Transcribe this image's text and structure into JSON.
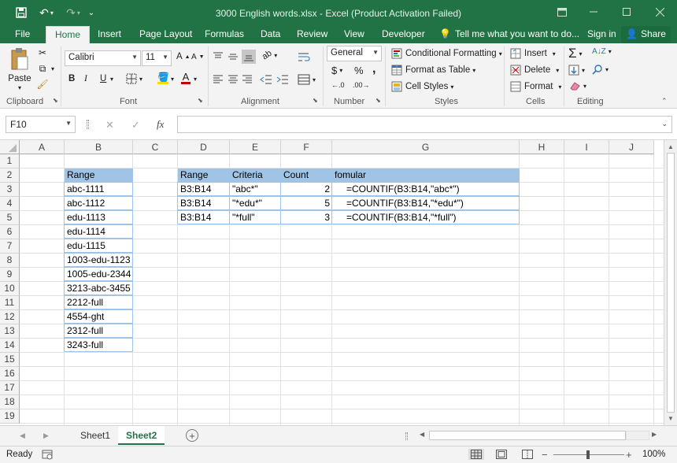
{
  "app": {
    "title": "3000 English words.xlsx - Excel (Product Activation Failed)",
    "colors": {
      "accent": "#217346",
      "header_fill": "#9fc4e6",
      "font_red": "#c00000",
      "fill_yellow": "#ffd800"
    }
  },
  "qat": {
    "save_icon": "save-icon",
    "undo_icon": "undo-icon",
    "redo_icon": "redo-icon"
  },
  "tabs": [
    {
      "label": "File"
    },
    {
      "label": "Home"
    },
    {
      "label": "Insert"
    },
    {
      "label": "Page Layout"
    },
    {
      "label": "Formulas"
    },
    {
      "label": "Data"
    },
    {
      "label": "Review"
    },
    {
      "label": "View"
    },
    {
      "label": "Developer"
    }
  ],
  "tellme": "Tell me what you want to do...",
  "signin": "Sign in",
  "share": "Share",
  "ribbon": {
    "clipboard": {
      "label": "Clipboard",
      "paste": "Paste"
    },
    "font": {
      "label": "Font",
      "family": "Calibri",
      "size": "11",
      "bold": "B",
      "italic": "I",
      "underline": "U"
    },
    "alignment": {
      "label": "Alignment"
    },
    "number": {
      "label": "Number",
      "format": "General",
      "currency": "$",
      "percent": "%",
      "comma": ","
    },
    "styles": {
      "label": "Styles",
      "conditional": "Conditional Formatting",
      "format_table": "Format as Table",
      "cell_styles": "Cell Styles"
    },
    "cells": {
      "label": "Cells",
      "insert": "Insert",
      "delete": "Delete",
      "format": "Format"
    },
    "editing": {
      "label": "Editing"
    }
  },
  "formula_bar": {
    "name_box": "F10",
    "fx": "fx",
    "content": ""
  },
  "columns": [
    "A",
    "B",
    "C",
    "D",
    "E",
    "F",
    "G",
    "H",
    "I",
    "J"
  ],
  "rows": [
    "1",
    "2",
    "3",
    "4",
    "5",
    "6",
    "7",
    "8",
    "9",
    "10",
    "11",
    "12",
    "13",
    "14",
    "15",
    "16",
    "17",
    "18",
    "19"
  ],
  "sheet": {
    "range_header": "Range",
    "range_values": [
      "abc-1111",
      "abc-1112",
      "edu-1113",
      "edu-1114",
      "edu-1115",
      "1003-edu-1123",
      "1005-edu-2344",
      "3213-abc-3455",
      "2212-full",
      "4554-ght",
      "2312-full",
      "3243-full"
    ],
    "table_headers": [
      "Range",
      "Criteria",
      "Count",
      "fomular"
    ],
    "table_rows": [
      {
        "range": "B3:B14",
        "criteria": "\"abc*\"",
        "count": "2",
        "formula": "=COUNTIF(B3:B14,\"abc*\")"
      },
      {
        "range": "B3:B14",
        "criteria": "\"*edu*\"",
        "count": "5",
        "formula": "=COUNTIF(B3:B14,\"*edu*\")"
      },
      {
        "range": "B3:B14",
        "criteria": "\"*full\"",
        "count": "3",
        "formula": "=COUNTIF(B3:B14,\"*full\")"
      }
    ]
  },
  "sheets": [
    {
      "label": "Sheet1"
    },
    {
      "label": "Sheet2",
      "active": true
    }
  ],
  "status": {
    "ready": "Ready",
    "zoom": "100%"
  }
}
